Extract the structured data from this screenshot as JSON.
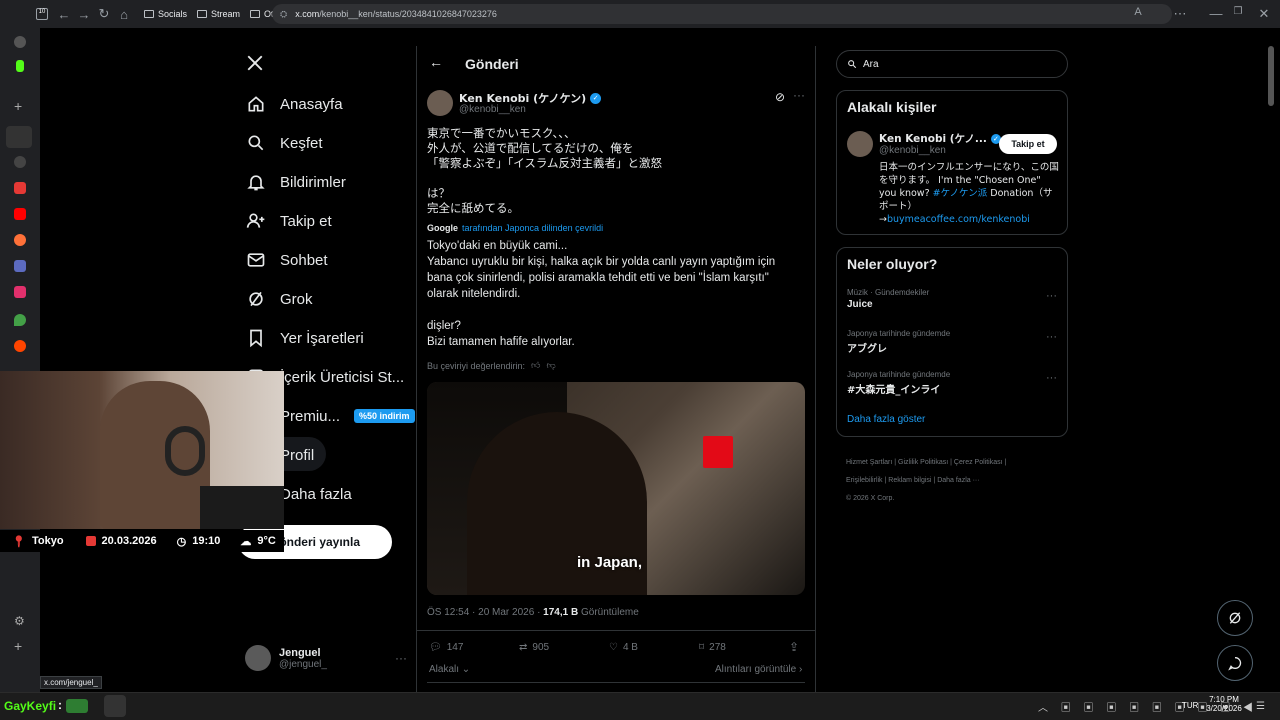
{
  "browser": {
    "tab_count": "10",
    "url_host": "x.com",
    "url_path": "/kenobi__ken/status/2034841026847023276",
    "bookmarks": [
      "Socials",
      "Stream",
      "Others"
    ],
    "status_url": "x.com/jenguel_"
  },
  "nav": {
    "home": "Anasayfa",
    "explore": "Keşfet",
    "notifications": "Bildirimler",
    "follow": "Takip et",
    "chat": "Sohbet",
    "grok": "Grok",
    "bookmarks": "Yer İşaretleri",
    "creator_studio": "İçerik Üreticisi St...",
    "premium": "Premiu...",
    "premium_badge": "%50 indirim",
    "profile": "Profil",
    "more": "Daha fazla",
    "post_button": "Gönderi yayınla",
    "account_name": "Jenguel",
    "account_handle": "@jenguel_"
  },
  "post": {
    "header_title": "Gönderi",
    "author_name": "Ken Kenobi (ケノケン)",
    "author_handle": "@kenobi__ken",
    "original_text": "東京で一番でかいモスク、、、\n外人が、公道で配信してるだけの、俺を\n「警察よぶぞ」「イスラム反対主義者」と激怒\n\nは？\n完全に舐めてる。",
    "translated_by_brand": "Google",
    "translated_by": "tarafından Japonca dilinden çevrildi",
    "translated_text": "Tokyo'daki en büyük cami...\nYabancı uyruklu bir kişi, halka açık bir yolda canlı yayın yaptığım için bana çok sinirlendi, polisi aramakla tehdit etti ve beni \"İslam karşıtı\" olarak nitelendirdi.\n\ndişler?\nBizi tamamen hafife alıyorlar.",
    "rate_translation": "Bu çeviriyi değerlendirin:",
    "video_caption": "in Japan,",
    "timestamp": "ÖS 12:54 · 20 Mar 2026 · ",
    "views_count": "174,1 B",
    "views_label": " Görüntüleme",
    "replies": "147",
    "reposts": "905",
    "likes": "4 B",
    "bookmarks": "278",
    "relevant_label": "Alakalı",
    "quotes_link": "Alıntıları görüntüle"
  },
  "right": {
    "search_placeholder": "Ara",
    "relevant_people_title": "Alakalı kişiler",
    "person_name": "Ken Kenobi (ケノ...",
    "person_handle": "@kenobi__ken",
    "follow_button": "Takip et",
    "bio_1": "日本一のインフルエンサーになり、この国を守ります。 I'm the \"Chosen One\" you know? ",
    "bio_tag": "#ケノケン派",
    "bio_2": " Donation（サポート）→",
    "bio_link": "buymeacoffee.com/kenkenobi",
    "trends_title": "Neler oluyor?",
    "trends": [
      {
        "category": "Müzik · Gündemdekiler",
        "name": "Juice"
      },
      {
        "category": "Japonya tarihinde gündemde",
        "name": "アブグレ"
      },
      {
        "category": "Japonya tarihinde gündemde",
        "name": "#大森元貴_インライ"
      }
    ],
    "show_more": "Daha fazla göster",
    "footer_links": [
      "Hizmet Şartları",
      "Gizlilik Politikası",
      "Çerez Politikası",
      "Erişilebilirlik",
      "Reklam bilgisi",
      "Daha fazla ···"
    ],
    "copyright": "© 2026 X Corp."
  },
  "overlay": {
    "city": "Tokyo",
    "date": "20.03.2026",
    "time": "19:10",
    "temp": "9°C"
  },
  "taskbar": {
    "label": "GayKeyfi",
    "lang": "TUR",
    "clock_time": "7:10 PM",
    "clock_date": "3/20/2026"
  },
  "colors": {
    "accent": "#1d9bf0",
    "background": "#000000",
    "border": "#2f3336"
  }
}
